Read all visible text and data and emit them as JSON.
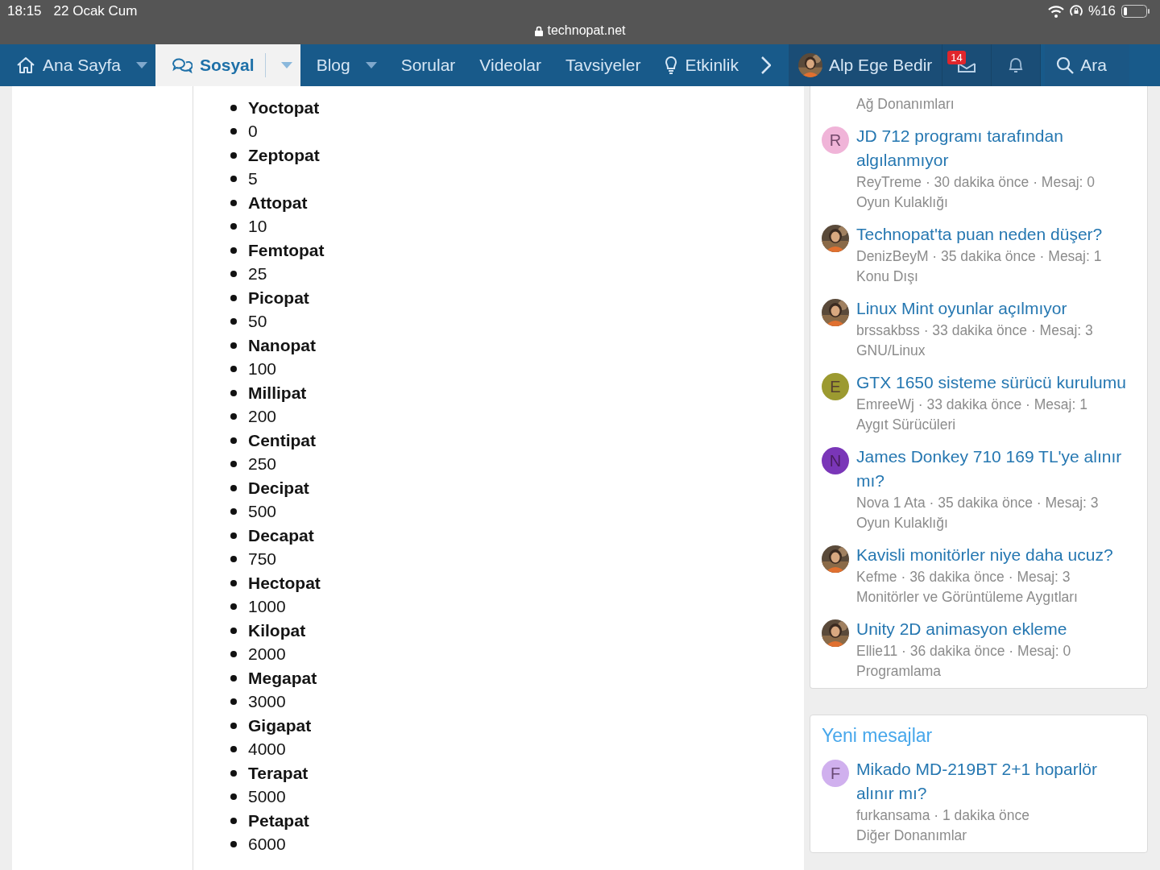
{
  "status_bar": {
    "time": "18:15",
    "date": "22 Ocak Cum",
    "url": "technopat.net",
    "battery": "%16"
  },
  "nav": {
    "items": [
      {
        "label": "Ana Sayfa",
        "kind": "home",
        "dropdown": true,
        "selected": false
      },
      {
        "label": "Sosyal",
        "kind": "chat",
        "dropdown": true,
        "selected": true
      },
      {
        "label": "Blog",
        "kind": "plain",
        "dropdown": true,
        "selected": false
      },
      {
        "label": "Sorular",
        "kind": "plain",
        "dropdown": false,
        "selected": false
      },
      {
        "label": "Videolar",
        "kind": "plain",
        "dropdown": false,
        "selected": false
      },
      {
        "label": "Tavsiyeler",
        "kind": "plain",
        "dropdown": false,
        "selected": false
      },
      {
        "label": "Etkinlik",
        "kind": "bulb",
        "dropdown": false,
        "selected": false
      }
    ],
    "user": "Alp Ege Bedir",
    "inbox_badge": "14",
    "search": "Ara"
  },
  "units": [
    {
      "name": "Yoctopat",
      "value": "0"
    },
    {
      "name": "Zeptopat",
      "value": "5"
    },
    {
      "name": "Attopat",
      "value": "10"
    },
    {
      "name": "Femtopat",
      "value": "25"
    },
    {
      "name": "Picopat",
      "value": "50"
    },
    {
      "name": "Nanopat",
      "value": "100"
    },
    {
      "name": "Millipat",
      "value": "200"
    },
    {
      "name": "Centipat",
      "value": "250"
    },
    {
      "name": "Decipat",
      "value": "500"
    },
    {
      "name": "Decapat",
      "value": "750"
    },
    {
      "name": "Hectopat",
      "value": "1000"
    },
    {
      "name": "Kilopat",
      "value": "2000"
    },
    {
      "name": "Megapat",
      "value": "3000"
    },
    {
      "name": "Gigapat",
      "value": "4000"
    },
    {
      "name": "Terapat",
      "value": "5000"
    },
    {
      "name": "Petapat",
      "value": "6000"
    }
  ],
  "latest_threads": {
    "top_category": "Ağ Donanımları",
    "items": [
      {
        "title": "JD 712 programı tarafından algılanmıyor",
        "avatar": {
          "kind": "letter",
          "letter": "R",
          "color": "#f0b4d8"
        },
        "meta": "ReyTreme · 30 dakika önce · Mesaj: 0",
        "category": "Oyun Kulaklığı"
      },
      {
        "title": "Technopat'ta puan neden düşer?",
        "meta": "DenizBeyM · 35 dakika önce · Mesaj: 1",
        "category": "Konu Dışı"
      },
      {
        "title": "Linux Mint oyunlar açılmıyor",
        "meta": "brssakbss · 33 dakika önce · Mesaj: 3",
        "category": "GNU/Linux"
      },
      {
        "title": "GTX 1650 sisteme sürücü kurulumu",
        "avatar": {
          "kind": "letter",
          "letter": "E",
          "color": "#9c9a30"
        },
        "meta": "EmreeWj · 33 dakika önce · Mesaj: 1",
        "category": "Aygıt Sürücüleri"
      },
      {
        "title": "James Donkey 710 169 TL'ye alınır mı?",
        "avatar": {
          "kind": "letter",
          "letter": "N",
          "color": "#7a36b8"
        },
        "meta": "Nova 1 Ata · 35 dakika önce · Mesaj: 3",
        "category": "Oyun Kulaklığı"
      },
      {
        "title": "Kavisli monitörler niye daha ucuz?",
        "meta": "Kefme · 36 dakika önce · Mesaj: 3",
        "category": "Monitörler ve Görüntüleme Aygıtları"
      },
      {
        "title": "Unity 2D animasyon ekleme",
        "meta": "Ellie11 · 36 dakika önce · Mesaj: 0",
        "category": "Programlama"
      }
    ]
  },
  "new_messages": {
    "title": "Yeni mesajlar",
    "items": [
      {
        "title": "Mikado MD-219BT 2+1 hoparlör alınır mı?",
        "avatar": {
          "kind": "letter",
          "letter": "F",
          "color": "#d0b0ee"
        },
        "meta": "furkansama · 1 dakika önce",
        "category": "Diğer Donanımlar"
      }
    ]
  }
}
